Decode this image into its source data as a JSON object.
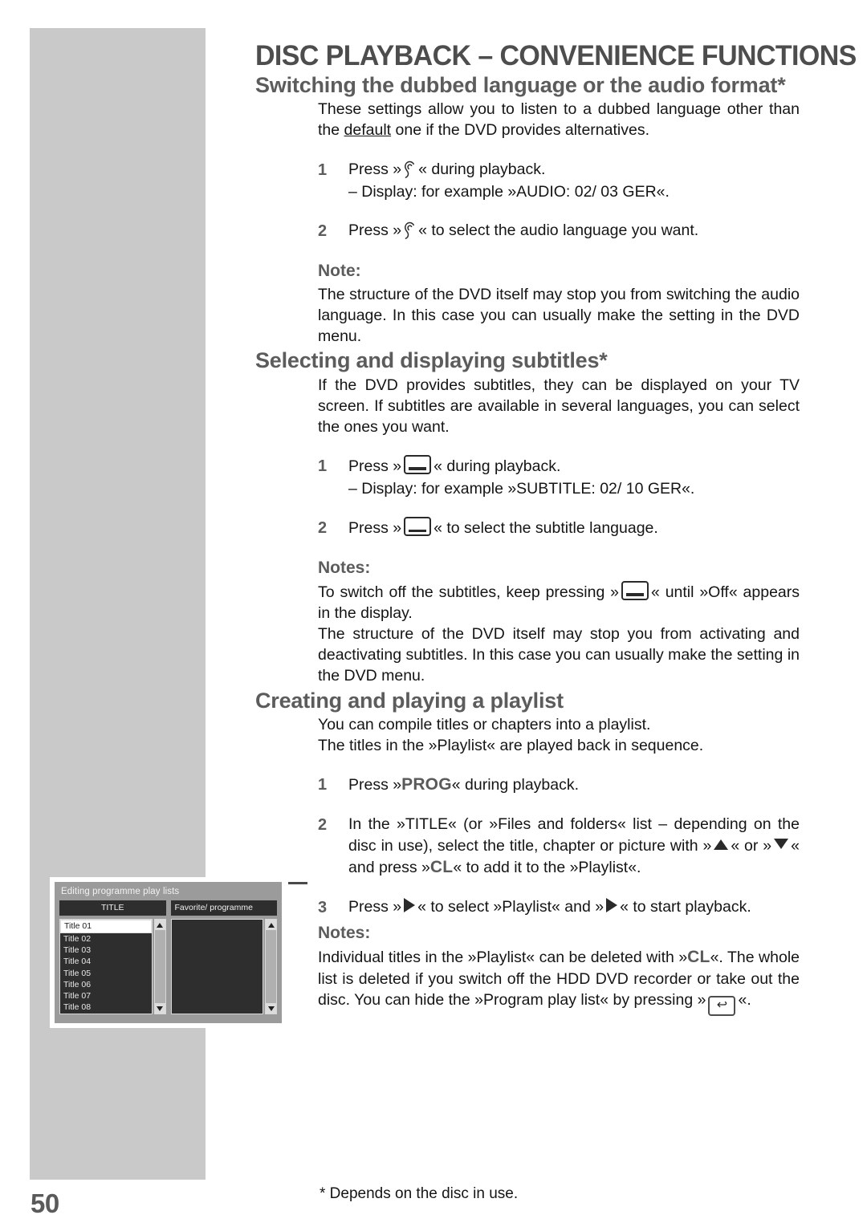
{
  "page": {
    "number": "50",
    "title": "DISC PLAYBACK – CONVENIENCE FUNCTIONS",
    "footnote": "* Depends on the disc in use."
  },
  "sections": [
    {
      "heading": "Switching the dubbed language or the audio format*",
      "intro_a": "These settings allow you to listen to a dubbed language other than the ",
      "intro_underlined": "default",
      "intro_b": " one if the DVD provides alternatives.",
      "steps": [
        {
          "num": "1",
          "text_a": "Press »",
          "icon": "ear-icon",
          "text_b": "« during playback.",
          "subline": "– Display: for example »AUDIO: 02/ 03 GER«."
        },
        {
          "num": "2",
          "text_a": "Press »",
          "icon": "ear-icon",
          "text_b": "« to select the audio language you want."
        }
      ],
      "note_heading": "Note:",
      "note_text": "The structure of the DVD itself may stop you from switching the audio language. In this case you can usually make the setting in the DVD menu."
    },
    {
      "heading": "Selecting and displaying subtitles*",
      "intro": "If the DVD provides subtitles, they can be displayed on your TV screen. If subtitles are available in several languages, you can select the ones you want.",
      "steps": [
        {
          "num": "1",
          "text_a": "Press »",
          "icon": "subtitle-icon",
          "text_b": "« during playback.",
          "subline": "– Display: for example »SUBTITLE: 02/ 10 GER«."
        },
        {
          "num": "2",
          "text_a": "Press »",
          "icon": "subtitle-icon",
          "text_b": "« to select the subtitle language."
        }
      ],
      "notes_heading": "Notes:",
      "note_1_a": "To switch off the subtitles, keep pressing »",
      "note_1_b": "« until »Off« appears in the display.",
      "note_2": "The structure of the DVD itself may stop you from activating and deactivating subtitles. In this case you can usually make the setting in the DVD menu."
    },
    {
      "heading": "Creating and playing a playlist",
      "intro_line_1": "You can compile titles or chapters into a playlist.",
      "intro_line_2": "The titles in the »Playlist« are played back in sequence.",
      "step_1_a": "Press »",
      "step_1_key": "PROG",
      "step_1_b": "« during playback.",
      "step_2_a": "In the »TITLE« (or »Files and folders« list – depending on the disc in use), select the title, chapter or picture with »",
      "step_2_b": "« or »",
      "step_2_c": "« and press »",
      "step_2_key": "CL",
      "step_2_d": "« to add it to the »Playlist«.",
      "step_3_a": "Press »",
      "step_3_b": "« to select »Playlist« and »",
      "step_3_c": "« to start playback.",
      "notes_heading": "Notes:",
      "note_a": "Individual titles in the »Playlist« can be deleted with »",
      "note_key": "CL",
      "note_b": "«. The whole list is deleted if you switch off the HDD DVD recorder or take out the disc. You can hide the »Program play list« by pressing »",
      "note_c": "«."
    }
  ],
  "device_screenshot": {
    "title": "Editing programme play lists",
    "left_column_header": "TITLE",
    "right_column_header": "Favorite/ programme",
    "left_items": [
      "Title 01",
      "Title 02",
      "Title 03",
      "Title 04",
      "Title 05",
      "Title 06",
      "Title 07",
      "Title 08"
    ],
    "selected_item": "Title 01",
    "right_items": []
  },
  "step_numbers": {
    "one": "1",
    "two": "2",
    "three": "3"
  },
  "colors": {
    "band_gray": "#c9c9c9",
    "heading_gray": "#5c5c5c",
    "screen_bg": "#9b9b9b",
    "list_bg": "#2e2e2e"
  }
}
